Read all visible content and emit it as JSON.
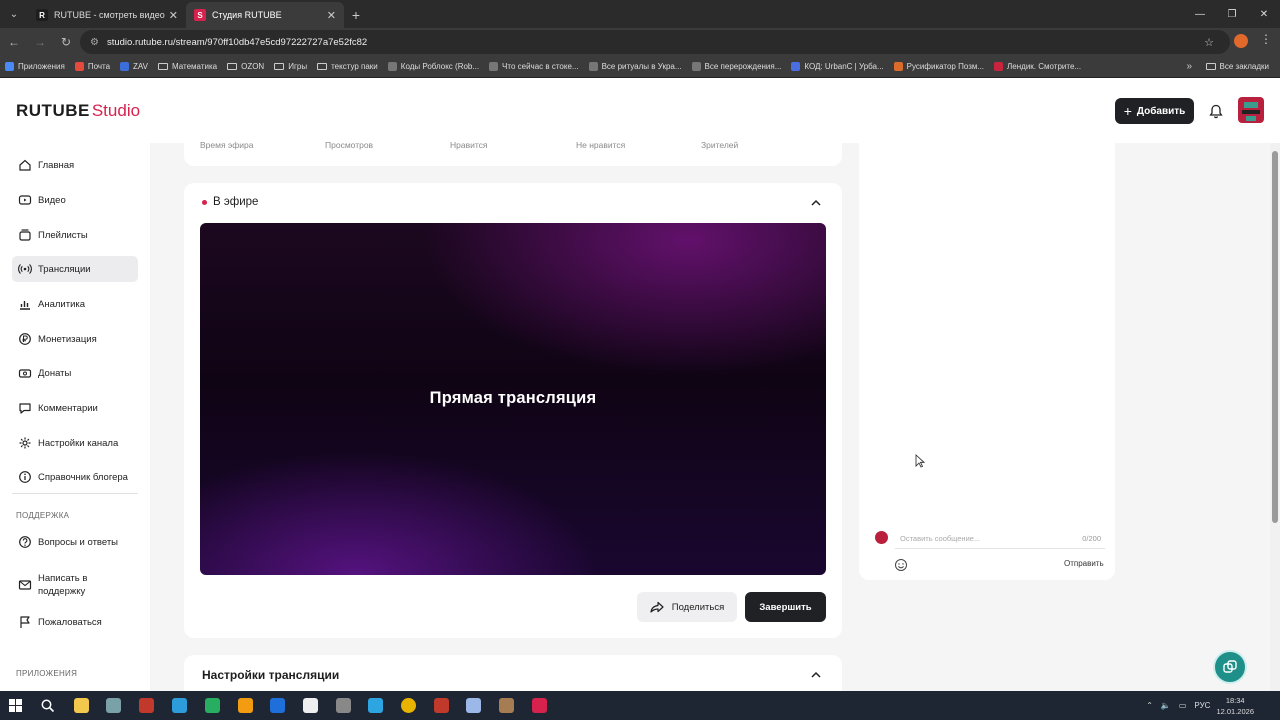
{
  "browser": {
    "tabs": [
      {
        "title": "RUTUBE - смотреть видео онлайн"
      },
      {
        "title": "Студия RUTUBE"
      }
    ],
    "url": "studio.rutube.ru/stream/970ff10db47e5cd97222727a7e52fc82",
    "bookmarks": [
      {
        "label": "Приложения",
        "color": "#4a8af4"
      },
      {
        "label": "Почта",
        "color": "#e44b3c"
      },
      {
        "label": "ZAV",
        "color": "#3b6ed8"
      },
      {
        "label": "Математика",
        "folder": true
      },
      {
        "label": "OZON",
        "folder": true
      },
      {
        "label": "Игры",
        "folder": true
      },
      {
        "label": "текстур паки",
        "folder": true
      },
      {
        "label": "Коды Роблокс (Rob...",
        "color": "#777"
      },
      {
        "label": "Что сейчас в стоке...",
        "color": "#777"
      },
      {
        "label": "Все ритуалы в Укра...",
        "color": "#777"
      },
      {
        "label": "Все перерождения...",
        "color": "#777"
      },
      {
        "label": "КОД: UrbanC | Урба...",
        "color": "#4a6de0"
      },
      {
        "label": "Русификатор Позм...",
        "color": "#d96b2b"
      },
      {
        "label": "Лендик. Смотрите...",
        "color": "#c9243f"
      }
    ],
    "all_bookmarks": "Все закладки"
  },
  "header": {
    "logo_main": "RUTUBE",
    "logo_studio": "Studio",
    "add_label": "Добавить"
  },
  "sidebar": {
    "items": [
      {
        "label": "Главная",
        "icon": "home-icon"
      },
      {
        "label": "Видео",
        "icon": "video-icon"
      },
      {
        "label": "Плейлисты",
        "icon": "playlist-icon"
      },
      {
        "label": "Трансляции",
        "icon": "broadcast-icon",
        "active": true
      },
      {
        "label": "Аналитика",
        "icon": "analytics-icon"
      },
      {
        "label": "Монетизация",
        "icon": "monetization-icon"
      },
      {
        "label": "Донаты",
        "icon": "donate-icon"
      },
      {
        "label": "Комментарии",
        "icon": "comments-icon"
      },
      {
        "label": "Настройки канала",
        "icon": "settings-icon"
      },
      {
        "label": "Справочник блогера",
        "icon": "info-icon"
      }
    ],
    "support_label": "ПОДДЕРЖКА",
    "support_items": [
      {
        "label": "Вопросы и ответы",
        "icon": "question-icon"
      },
      {
        "label": "Написать в поддержку",
        "icon": "mail-icon"
      },
      {
        "label": "Пожаловаться",
        "icon": "flag-icon"
      }
    ],
    "apps_label": "ПРИЛОЖЕНИЯ"
  },
  "stats": {
    "labels": [
      "Время эфира",
      "Просмотров",
      "Нравится",
      "Не нравится",
      "Зрителей"
    ]
  },
  "live": {
    "status": "В эфире",
    "player_title": "Прямая трансляция",
    "share_label": "Поделиться",
    "finish_label": "Завершить"
  },
  "settings": {
    "title": "Настройки трансляции"
  },
  "chat": {
    "placeholder": "Оставить сообщение...",
    "counter": "0/200",
    "send_label": "Отправить"
  },
  "taskbar": {
    "lang": "РУС",
    "time": "18:34",
    "date": "12.01.2026"
  },
  "colors": {
    "brand_red": "#d6224d",
    "dark_button": "#1f2125",
    "support_fab": "#1f8f8a"
  }
}
